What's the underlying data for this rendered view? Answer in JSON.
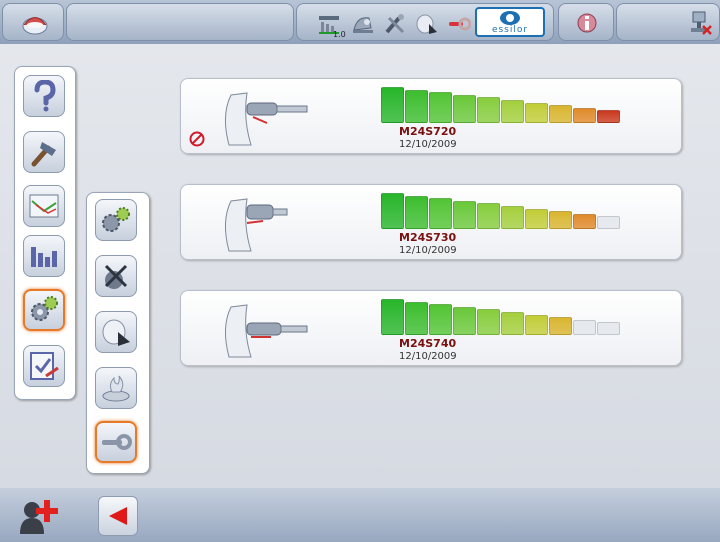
{
  "topbar": {
    "version_label": "1.0",
    "brand_label": "essilor",
    "icons": [
      "home-icon",
      "calibration-icon",
      "edging-icon",
      "tools-icon",
      "lens-icon",
      "wrench-icon",
      "essilor-logo-icon",
      "info-icon",
      "network-icon"
    ]
  },
  "sidebar_primary": {
    "items": [
      "help-icon",
      "hammer-icon",
      "graph-icon",
      "statistics-icon",
      "settings-gears-icon",
      "checklist-icon"
    ],
    "selected": "settings-gears-icon"
  },
  "sidebar_secondary": {
    "items": [
      "gears-icon",
      "tool-setup-icon",
      "grinding-wheel-icon",
      "coolant-icon",
      "wrench-icon"
    ],
    "selected": "wrench-icon"
  },
  "tools": [
    {
      "name": "M24S720",
      "date": "12/10/2009",
      "forbidden": true,
      "level": 10
    },
    {
      "name": "M24S730",
      "date": "12/10/2009",
      "forbidden": false,
      "level": 9
    },
    {
      "name": "M24S740",
      "date": "12/10/2009",
      "forbidden": false,
      "level": 8
    }
  ],
  "bar_colors": [
    "#27b52a",
    "#3cbd2e",
    "#52c434",
    "#6ac83a",
    "#86cd3d",
    "#a4cf3d",
    "#c2cd37",
    "#d9b52f",
    "#e08a2a",
    "#c9391e"
  ],
  "bar_empty_color": "#e6e9ee",
  "bottombar": {
    "icons": [
      "add-user-icon",
      "back-arrow-icon"
    ]
  }
}
